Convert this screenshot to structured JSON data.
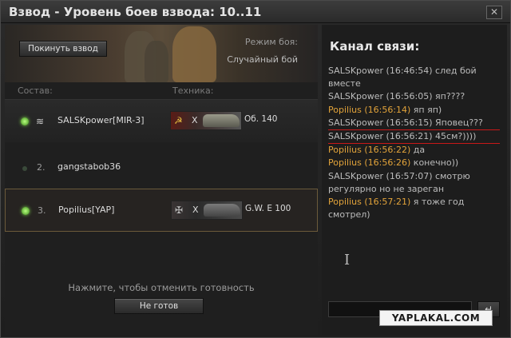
{
  "window": {
    "title": "Взвод - Уровень боев взвода: 10..11",
    "close_glyph": "✕"
  },
  "banner": {
    "leave_label": "Покинуть взвод",
    "mode_label": "Режим боя:",
    "mode_value": "Случайный бой"
  },
  "columns": {
    "roster": "Состав:",
    "vehicle": "Техника:"
  },
  "members": [
    {
      "ready": true,
      "number": "",
      "name": "SALSKpower[MIR-3]",
      "has_tank": true,
      "nation": "☭",
      "tier": "X",
      "tank": "Об. 140"
    },
    {
      "ready": false,
      "number": "2.",
      "name": "gangstabob36",
      "has_tank": false
    },
    {
      "ready": true,
      "number": "3.",
      "name": "Popilius[YAP]",
      "has_tank": true,
      "nation": "✠",
      "tier": "X",
      "tank": "G.W. E 100"
    }
  ],
  "footer": {
    "hint": "Нажмите, чтобы отменить готовность",
    "not_ready_label": "Не готов"
  },
  "chat": {
    "title": "Канал связи:",
    "messages": [
      {
        "who": "SALSKpower (16:46:54)",
        "text": " след бой вместе",
        "author": "salsk"
      },
      {
        "who": "SALSKpower (16:56:05)",
        "text": " яп????",
        "author": "salsk"
      },
      {
        "who": "Popilius (16:56:14)",
        "text": " яп яп)",
        "author": "pop"
      },
      {
        "who": "SALSKpower (16:56:15)",
        "text": " Яповец???",
        "author": "salsk"
      },
      {
        "who": "SALSKpower (16:56:21)",
        "text": " 45см?))))",
        "author": "salsk"
      },
      {
        "who": "Popilius (16:56:22)",
        "text": " да",
        "author": "pop"
      },
      {
        "who": "Popilius (16:56:26)",
        "text": " конечно))",
        "author": "pop"
      },
      {
        "who": "SALSKpower (16:57:07)",
        "text": " смотрю регулярно но не зареган",
        "author": "salsk"
      },
      {
        "who": "Popilius (16:57:21)",
        "text": " я тоже год смотрел)",
        "author": "pop"
      }
    ],
    "input_value": "",
    "send_glyph": "↵"
  },
  "watermark": "YAPLAKAL.COM",
  "colors": {
    "accent_orange": "#e2a33a",
    "ready_green": "#7dd34a",
    "highlight_red": "#c81818"
  }
}
